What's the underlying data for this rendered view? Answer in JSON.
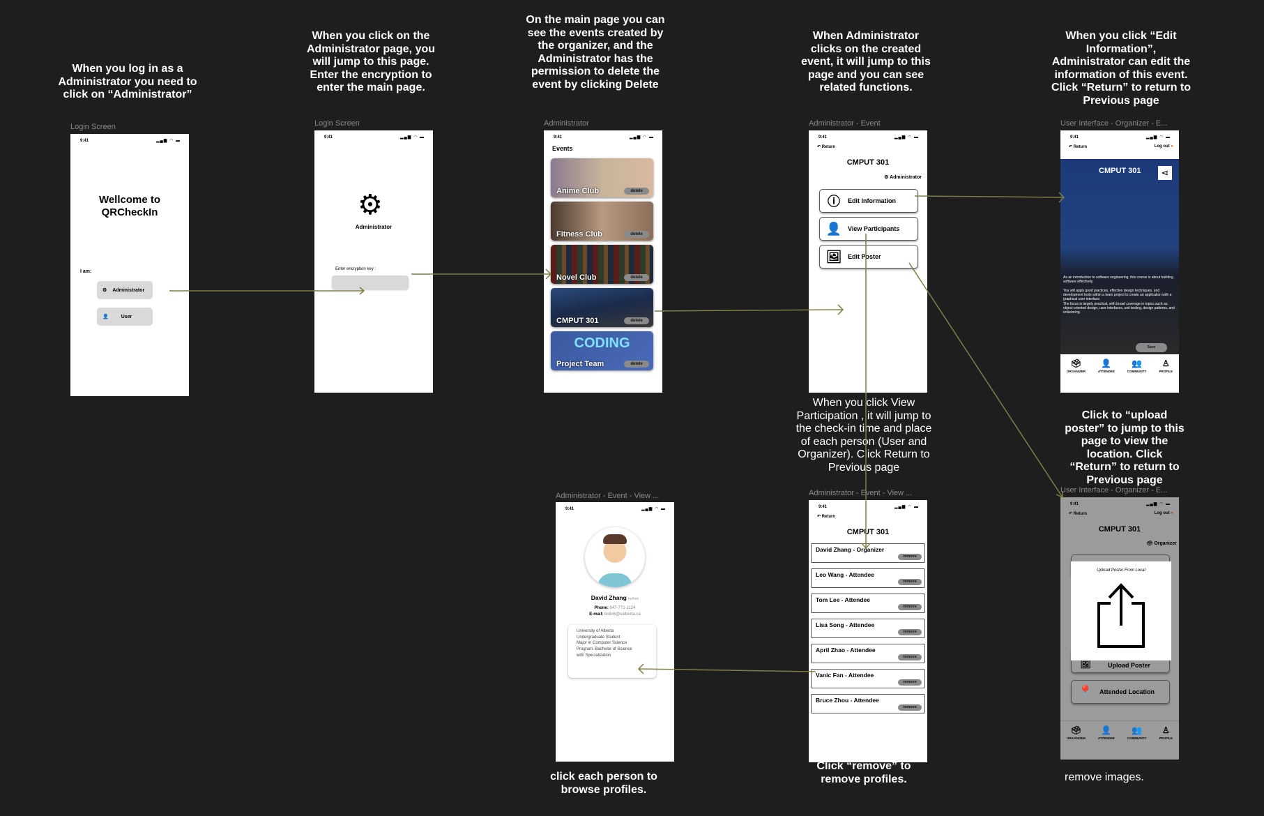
{
  "captions": {
    "login": "When you log in as a Administrator you need to click on “Administrator”",
    "admin_page": "When you click on the Administrator page, you will jump to this page. Enter the encryption to enter the main page.",
    "main_page": "On the main page you can see the events created by the organizer, and the Administrator has the permission to delete the event by clicking Delete",
    "event": "When Administrator clicks on the created event, it will jump to this page and you can see related functions.",
    "edit_info": "When you click “Edit Information”, Administrator can edit the information of this event. Click “Return” to return to Previous page",
    "view_participation": "When you click View Participation , it will jump to the check-in time and place of each person (User and Organizer). Click Return to Previous page",
    "upload_poster": "Click to “upload poster” to jump to this page to view the location. Click “Return” to return to Previous page",
    "browse": "click each person  to browse profiles.",
    "remove": "Click “remove” to remove profiles.",
    "remove_images": "remove images."
  },
  "frame_labels": {
    "f1": "Login Screen",
    "f2": "Login Screen",
    "f3": "Administrator",
    "f4": "Administrator - Event",
    "f5": "User Interface - Organizer - E...",
    "f6": "Administrator - Event - View ...",
    "f7": "Administrator - Event - View ...",
    "f8": "User Interface - Organizer - E..."
  },
  "status": {
    "time": "9:41",
    "icons": "▂▄▆ ◠ ▬"
  },
  "login": {
    "title": "Wellcome to QRCheckIn",
    "iam": "I am:",
    "admin": "Administrator",
    "user": "User"
  },
  "admin_login": {
    "label": "Administrator",
    "key_label": "Enter encryption key :",
    "key_value": ""
  },
  "events": {
    "title": "Events",
    "delete": "delete",
    "items": [
      {
        "name": "Anime Club",
        "bg": "linear-gradient(90deg,#8b7a8f,#c7b49a 50%,#d9b9a0)"
      },
      {
        "name": "Fitness Club",
        "bg": "linear-gradient(90deg,#4a3a30,#b89a80 50%,#8a6e5a)"
      },
      {
        "name": "Novel Club",
        "bg": "repeating-linear-gradient(90deg,#5a1e1a 0 8px,#2e3a2a 8px 16px,#6a4a2a 16px 22px,#1e2a3a 22px 30px)"
      },
      {
        "name": "CMPUT 301",
        "bg": "linear-gradient(170deg,#2a4a7a,#1a2a4a 50%,#3a3a3a)"
      },
      {
        "name": "Project Team",
        "bg": "linear-gradient(135deg,#3a5aa0,#4a6ab8)",
        "banner": "CODING"
      }
    ]
  },
  "event": {
    "return": "Return",
    "title": "CMPUT 301",
    "role": "Administrator",
    "buttons": [
      "Edit Information",
      "View Participants",
      "Edit Poster"
    ]
  },
  "edit": {
    "return": "Return",
    "logout": "Log out",
    "title": "CMPUT 301",
    "desc": "As an introduction to software engineering, this course is about building software effectively.\n\nYou will apply good practices, effective design techniques, and development tools within a team project to create an application with a graphical user interface.\nThe focus is largely practical, with broad coverage in topics such as: object-oriented design, user interfaces, unit testing, design patterns, and refactoring.",
    "save": "Save"
  },
  "nav": [
    "ORGANIZER",
    "ATTENDEE",
    "COMMUNITY",
    "PROFILE"
  ],
  "profile": {
    "name": "David Zhang",
    "pronoun": "he/him",
    "phone_label": "Phone:",
    "phone": "647-771-1124",
    "email_label": "E-mail:",
    "email": "bolin6@ualberta.ca",
    "bio": "University of Alberta\nUndergraduate Student\nMajor in Computer Science\nProgram: Bachelor of Science\nwith Specialization"
  },
  "participants": {
    "return": "Return",
    "title": "CMPUT 301",
    "remove": "remove",
    "items": [
      "David Zhang - Organizer",
      "Leo Wang - Attendee",
      "Tom Lee - Attendee",
      "Lisa Song - Attendee",
      "April Zhao - Attendee",
      "Vanic Fan - Attendee",
      "Bruce Zhou - Attendee"
    ]
  },
  "upload": {
    "return": "Return",
    "logout": "Log out",
    "title": "CMPUT 301",
    "role": "Organizer",
    "modal_title": "Upload Poster From Local",
    "upload_btn": "Upload Poster",
    "location_btn": "Attended Location"
  },
  "colors": {
    "arrow": "#7f7f45",
    "bg": "#1e1e1e"
  }
}
